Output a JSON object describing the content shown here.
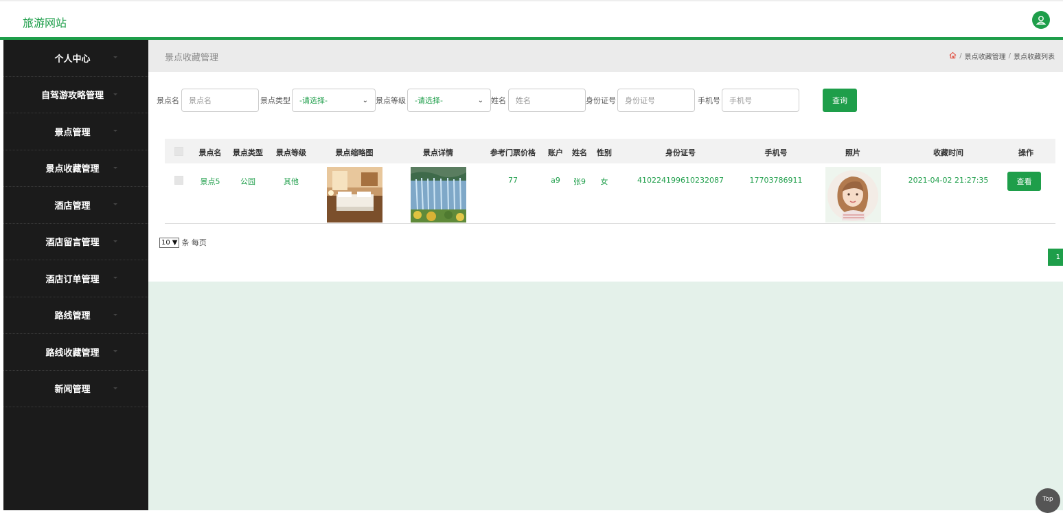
{
  "header": {
    "brand": "旅游网站",
    "user_icon": "user-icon"
  },
  "sidebar": {
    "items": [
      {
        "label": "个人中心"
      },
      {
        "label": "自驾游攻略管理"
      },
      {
        "label": "景点管理"
      },
      {
        "label": "景点收藏管理"
      },
      {
        "label": "酒店管理"
      },
      {
        "label": "酒店留言管理"
      },
      {
        "label": "酒店订单管理"
      },
      {
        "label": "路线管理"
      },
      {
        "label": "路线收藏管理"
      },
      {
        "label": "新闻管理"
      }
    ]
  },
  "page": {
    "title": "景点收藏管理",
    "breadcrumb": {
      "home_icon": "home-icon",
      "sep": "/",
      "level1": "景点收藏管理",
      "level2": "景点收藏列表"
    }
  },
  "filters": {
    "name_label": "景点名",
    "name_placeholder": "景点名",
    "type_label": "景点类型",
    "type_value": "-请选择-",
    "level_label": "景点等级",
    "level_value": "-请选择-",
    "person_label": "姓名",
    "person_placeholder": "姓名",
    "id_label": "身份证号",
    "id_placeholder": "身份证号",
    "phone_label": "手机号",
    "phone_placeholder": "手机号",
    "query_button": "查询"
  },
  "table": {
    "headers": [
      "景点名",
      "景点类型",
      "景点等级",
      "景点缩略图",
      "景点详情",
      "参考门票价格",
      "账户",
      "姓名",
      "性别",
      "身份证号",
      "手机号",
      "照片",
      "收藏时间",
      "操作"
    ],
    "rows": [
      {
        "name": "景点5",
        "type": "公园",
        "level": "其他",
        "price": "77",
        "account": "a9",
        "person": "张9",
        "gender": "女",
        "id_no": "410224199610232087",
        "phone": "17703786911",
        "time": "2021-04-02 21:27:35",
        "action": "查看"
      }
    ]
  },
  "pagination": {
    "page_size": "10",
    "per_page_label": "条 每页",
    "current_page": "1"
  },
  "top_button": "Top",
  "colors": {
    "accent": "#1e9e4a",
    "sidebar_bg": "#1b1b1b",
    "content_bg": "#e4f1ea"
  }
}
